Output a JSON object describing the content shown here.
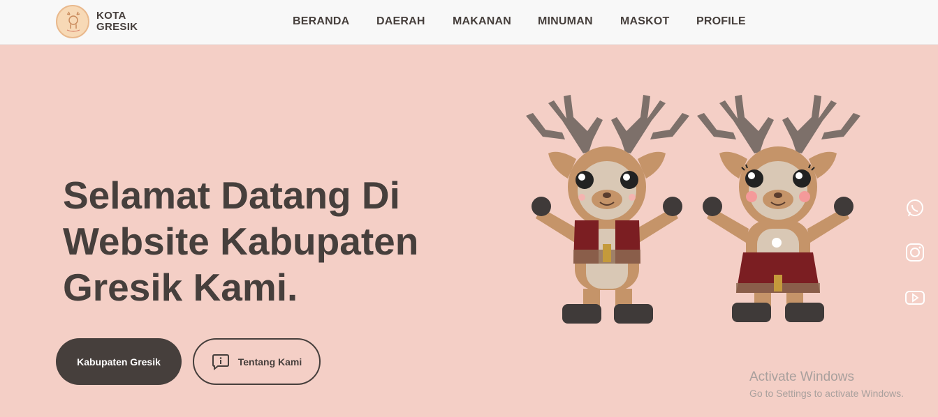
{
  "brand": {
    "line1": "KOTA",
    "line2": "GRESIK"
  },
  "nav": {
    "items": [
      {
        "label": "BERANDA"
      },
      {
        "label": "DAERAH"
      },
      {
        "label": "MAKANAN"
      },
      {
        "label": "MINUMAN"
      },
      {
        "label": "MASKOT"
      },
      {
        "label": "PROFILE"
      }
    ]
  },
  "hero": {
    "title_line1": "Selamat Datang Di",
    "title_line2": "Website Kabupaten",
    "title_line3": "Gresik Kami.",
    "primary_button": "Kabupaten Gresik",
    "secondary_button": "Tentang Kami"
  },
  "social": [
    {
      "icon": "whatsapp-icon"
    },
    {
      "icon": "instagram-icon"
    },
    {
      "icon": "youtube-icon"
    }
  ],
  "watermark": {
    "title": "Activate Windows",
    "subtitle": "Go to Settings to activate Windows."
  },
  "colors": {
    "background": "#f4cfc6",
    "navbar": "#f8f8f8",
    "text": "#463f3c",
    "button_dark": "#463f3c"
  }
}
